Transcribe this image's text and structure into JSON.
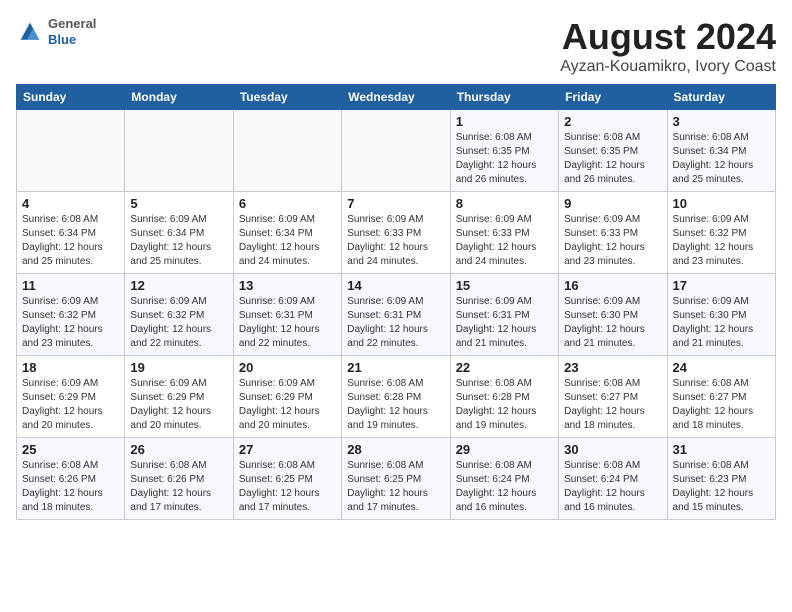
{
  "header": {
    "logo_general": "General",
    "logo_blue": "Blue",
    "title": "August 2024",
    "subtitle": "Ayzan-Kouamikro, Ivory Coast"
  },
  "days_of_week": [
    "Sunday",
    "Monday",
    "Tuesday",
    "Wednesday",
    "Thursday",
    "Friday",
    "Saturday"
  ],
  "weeks": [
    [
      {
        "day": "",
        "info": ""
      },
      {
        "day": "",
        "info": ""
      },
      {
        "day": "",
        "info": ""
      },
      {
        "day": "",
        "info": ""
      },
      {
        "day": "1",
        "info": "Sunrise: 6:08 AM\nSunset: 6:35 PM\nDaylight: 12 hours\nand 26 minutes."
      },
      {
        "day": "2",
        "info": "Sunrise: 6:08 AM\nSunset: 6:35 PM\nDaylight: 12 hours\nand 26 minutes."
      },
      {
        "day": "3",
        "info": "Sunrise: 6:08 AM\nSunset: 6:34 PM\nDaylight: 12 hours\nand 25 minutes."
      }
    ],
    [
      {
        "day": "4",
        "info": "Sunrise: 6:08 AM\nSunset: 6:34 PM\nDaylight: 12 hours\nand 25 minutes."
      },
      {
        "day": "5",
        "info": "Sunrise: 6:09 AM\nSunset: 6:34 PM\nDaylight: 12 hours\nand 25 minutes."
      },
      {
        "day": "6",
        "info": "Sunrise: 6:09 AM\nSunset: 6:34 PM\nDaylight: 12 hours\nand 24 minutes."
      },
      {
        "day": "7",
        "info": "Sunrise: 6:09 AM\nSunset: 6:33 PM\nDaylight: 12 hours\nand 24 minutes."
      },
      {
        "day": "8",
        "info": "Sunrise: 6:09 AM\nSunset: 6:33 PM\nDaylight: 12 hours\nand 24 minutes."
      },
      {
        "day": "9",
        "info": "Sunrise: 6:09 AM\nSunset: 6:33 PM\nDaylight: 12 hours\nand 23 minutes."
      },
      {
        "day": "10",
        "info": "Sunrise: 6:09 AM\nSunset: 6:32 PM\nDaylight: 12 hours\nand 23 minutes."
      }
    ],
    [
      {
        "day": "11",
        "info": "Sunrise: 6:09 AM\nSunset: 6:32 PM\nDaylight: 12 hours\nand 23 minutes."
      },
      {
        "day": "12",
        "info": "Sunrise: 6:09 AM\nSunset: 6:32 PM\nDaylight: 12 hours\nand 22 minutes."
      },
      {
        "day": "13",
        "info": "Sunrise: 6:09 AM\nSunset: 6:31 PM\nDaylight: 12 hours\nand 22 minutes."
      },
      {
        "day": "14",
        "info": "Sunrise: 6:09 AM\nSunset: 6:31 PM\nDaylight: 12 hours\nand 22 minutes."
      },
      {
        "day": "15",
        "info": "Sunrise: 6:09 AM\nSunset: 6:31 PM\nDaylight: 12 hours\nand 21 minutes."
      },
      {
        "day": "16",
        "info": "Sunrise: 6:09 AM\nSunset: 6:30 PM\nDaylight: 12 hours\nand 21 minutes."
      },
      {
        "day": "17",
        "info": "Sunrise: 6:09 AM\nSunset: 6:30 PM\nDaylight: 12 hours\nand 21 minutes."
      }
    ],
    [
      {
        "day": "18",
        "info": "Sunrise: 6:09 AM\nSunset: 6:29 PM\nDaylight: 12 hours\nand 20 minutes."
      },
      {
        "day": "19",
        "info": "Sunrise: 6:09 AM\nSunset: 6:29 PM\nDaylight: 12 hours\nand 20 minutes."
      },
      {
        "day": "20",
        "info": "Sunrise: 6:09 AM\nSunset: 6:29 PM\nDaylight: 12 hours\nand 20 minutes."
      },
      {
        "day": "21",
        "info": "Sunrise: 6:08 AM\nSunset: 6:28 PM\nDaylight: 12 hours\nand 19 minutes."
      },
      {
        "day": "22",
        "info": "Sunrise: 6:08 AM\nSunset: 6:28 PM\nDaylight: 12 hours\nand 19 minutes."
      },
      {
        "day": "23",
        "info": "Sunrise: 6:08 AM\nSunset: 6:27 PM\nDaylight: 12 hours\nand 18 minutes."
      },
      {
        "day": "24",
        "info": "Sunrise: 6:08 AM\nSunset: 6:27 PM\nDaylight: 12 hours\nand 18 minutes."
      }
    ],
    [
      {
        "day": "25",
        "info": "Sunrise: 6:08 AM\nSunset: 6:26 PM\nDaylight: 12 hours\nand 18 minutes."
      },
      {
        "day": "26",
        "info": "Sunrise: 6:08 AM\nSunset: 6:26 PM\nDaylight: 12 hours\nand 17 minutes."
      },
      {
        "day": "27",
        "info": "Sunrise: 6:08 AM\nSunset: 6:25 PM\nDaylight: 12 hours\nand 17 minutes."
      },
      {
        "day": "28",
        "info": "Sunrise: 6:08 AM\nSunset: 6:25 PM\nDaylight: 12 hours\nand 17 minutes."
      },
      {
        "day": "29",
        "info": "Sunrise: 6:08 AM\nSunset: 6:24 PM\nDaylight: 12 hours\nand 16 minutes."
      },
      {
        "day": "30",
        "info": "Sunrise: 6:08 AM\nSunset: 6:24 PM\nDaylight: 12 hours\nand 16 minutes."
      },
      {
        "day": "31",
        "info": "Sunrise: 6:08 AM\nSunset: 6:23 PM\nDaylight: 12 hours\nand 15 minutes."
      }
    ]
  ]
}
